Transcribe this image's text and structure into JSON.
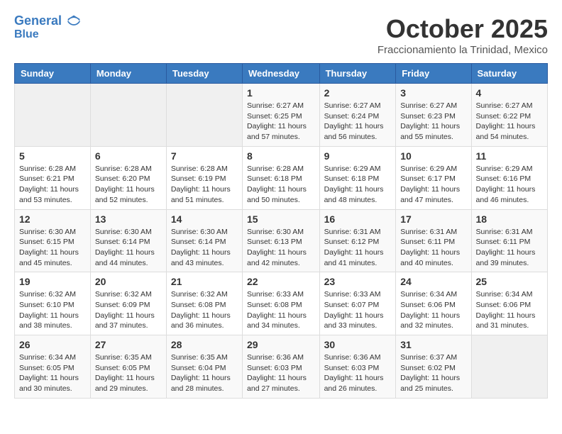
{
  "header": {
    "logo_line1": "General",
    "logo_line2": "Blue",
    "month_title": "October 2025",
    "location": "Fraccionamiento la Trinidad, Mexico"
  },
  "weekdays": [
    "Sunday",
    "Monday",
    "Tuesday",
    "Wednesday",
    "Thursday",
    "Friday",
    "Saturday"
  ],
  "weeks": [
    [
      {
        "day": "",
        "content": ""
      },
      {
        "day": "",
        "content": ""
      },
      {
        "day": "",
        "content": ""
      },
      {
        "day": "1",
        "content": "Sunrise: 6:27 AM\nSunset: 6:25 PM\nDaylight: 11 hours and 57 minutes."
      },
      {
        "day": "2",
        "content": "Sunrise: 6:27 AM\nSunset: 6:24 PM\nDaylight: 11 hours and 56 minutes."
      },
      {
        "day": "3",
        "content": "Sunrise: 6:27 AM\nSunset: 6:23 PM\nDaylight: 11 hours and 55 minutes."
      },
      {
        "day": "4",
        "content": "Sunrise: 6:27 AM\nSunset: 6:22 PM\nDaylight: 11 hours and 54 minutes."
      }
    ],
    [
      {
        "day": "5",
        "content": "Sunrise: 6:28 AM\nSunset: 6:21 PM\nDaylight: 11 hours and 53 minutes."
      },
      {
        "day": "6",
        "content": "Sunrise: 6:28 AM\nSunset: 6:20 PM\nDaylight: 11 hours and 52 minutes."
      },
      {
        "day": "7",
        "content": "Sunrise: 6:28 AM\nSunset: 6:19 PM\nDaylight: 11 hours and 51 minutes."
      },
      {
        "day": "8",
        "content": "Sunrise: 6:28 AM\nSunset: 6:18 PM\nDaylight: 11 hours and 50 minutes."
      },
      {
        "day": "9",
        "content": "Sunrise: 6:29 AM\nSunset: 6:18 PM\nDaylight: 11 hours and 48 minutes."
      },
      {
        "day": "10",
        "content": "Sunrise: 6:29 AM\nSunset: 6:17 PM\nDaylight: 11 hours and 47 minutes."
      },
      {
        "day": "11",
        "content": "Sunrise: 6:29 AM\nSunset: 6:16 PM\nDaylight: 11 hours and 46 minutes."
      }
    ],
    [
      {
        "day": "12",
        "content": "Sunrise: 6:30 AM\nSunset: 6:15 PM\nDaylight: 11 hours and 45 minutes."
      },
      {
        "day": "13",
        "content": "Sunrise: 6:30 AM\nSunset: 6:14 PM\nDaylight: 11 hours and 44 minutes."
      },
      {
        "day": "14",
        "content": "Sunrise: 6:30 AM\nSunset: 6:14 PM\nDaylight: 11 hours and 43 minutes."
      },
      {
        "day": "15",
        "content": "Sunrise: 6:30 AM\nSunset: 6:13 PM\nDaylight: 11 hours and 42 minutes."
      },
      {
        "day": "16",
        "content": "Sunrise: 6:31 AM\nSunset: 6:12 PM\nDaylight: 11 hours and 41 minutes."
      },
      {
        "day": "17",
        "content": "Sunrise: 6:31 AM\nSunset: 6:11 PM\nDaylight: 11 hours and 40 minutes."
      },
      {
        "day": "18",
        "content": "Sunrise: 6:31 AM\nSunset: 6:11 PM\nDaylight: 11 hours and 39 minutes."
      }
    ],
    [
      {
        "day": "19",
        "content": "Sunrise: 6:32 AM\nSunset: 6:10 PM\nDaylight: 11 hours and 38 minutes."
      },
      {
        "day": "20",
        "content": "Sunrise: 6:32 AM\nSunset: 6:09 PM\nDaylight: 11 hours and 37 minutes."
      },
      {
        "day": "21",
        "content": "Sunrise: 6:32 AM\nSunset: 6:08 PM\nDaylight: 11 hours and 36 minutes."
      },
      {
        "day": "22",
        "content": "Sunrise: 6:33 AM\nSunset: 6:08 PM\nDaylight: 11 hours and 34 minutes."
      },
      {
        "day": "23",
        "content": "Sunrise: 6:33 AM\nSunset: 6:07 PM\nDaylight: 11 hours and 33 minutes."
      },
      {
        "day": "24",
        "content": "Sunrise: 6:34 AM\nSunset: 6:06 PM\nDaylight: 11 hours and 32 minutes."
      },
      {
        "day": "25",
        "content": "Sunrise: 6:34 AM\nSunset: 6:06 PM\nDaylight: 11 hours and 31 minutes."
      }
    ],
    [
      {
        "day": "26",
        "content": "Sunrise: 6:34 AM\nSunset: 6:05 PM\nDaylight: 11 hours and 30 minutes."
      },
      {
        "day": "27",
        "content": "Sunrise: 6:35 AM\nSunset: 6:05 PM\nDaylight: 11 hours and 29 minutes."
      },
      {
        "day": "28",
        "content": "Sunrise: 6:35 AM\nSunset: 6:04 PM\nDaylight: 11 hours and 28 minutes."
      },
      {
        "day": "29",
        "content": "Sunrise: 6:36 AM\nSunset: 6:03 PM\nDaylight: 11 hours and 27 minutes."
      },
      {
        "day": "30",
        "content": "Sunrise: 6:36 AM\nSunset: 6:03 PM\nDaylight: 11 hours and 26 minutes."
      },
      {
        "day": "31",
        "content": "Sunrise: 6:37 AM\nSunset: 6:02 PM\nDaylight: 11 hours and 25 minutes."
      },
      {
        "day": "",
        "content": ""
      }
    ]
  ]
}
